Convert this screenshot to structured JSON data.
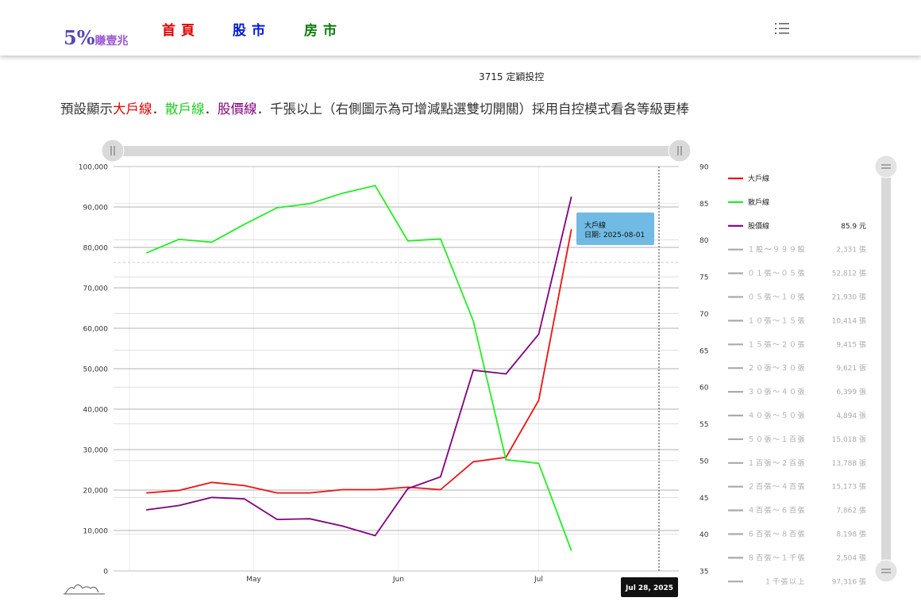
{
  "header": {
    "logo_main": "5%",
    "logo_sub": "賺壹兆",
    "nav": [
      {
        "label": "首頁",
        "color": "#e00000"
      },
      {
        "label": "股市",
        "color": "#0018d8"
      },
      {
        "label": "房市",
        "color": "#0a7a0a"
      }
    ],
    "menu_icon": "list-menu-icon"
  },
  "page_title": "3715 定穎投控",
  "intro": [
    {
      "text": "預設顯示",
      "color": "#333333"
    },
    {
      "text": "大戶線",
      "color": "#e00000"
    },
    {
      "text": "．",
      "color": "#333333"
    },
    {
      "text": "散戶線",
      "color": "#22cc22"
    },
    {
      "text": "．",
      "color": "#333333"
    },
    {
      "text": "股價線",
      "color": "#800080"
    },
    {
      "text": "．千張以上（右側圖示為可增減點選雙切開關）採用自控模式看各等級更棒",
      "color": "#333333"
    }
  ],
  "chart_data": {
    "type": "line",
    "x_ticks": [
      {
        "label": "May",
        "date": "2025-05-01"
      },
      {
        "label": "Jun",
        "date": "2025-06-01"
      },
      {
        "label": "Jul",
        "date": "2025-07-01"
      }
    ],
    "x": [
      "2025-04-08",
      "2025-04-15",
      "2025-04-22",
      "2025-04-29",
      "2025-05-06",
      "2025-05-13",
      "2025-05-20",
      "2025-05-27",
      "2025-06-03",
      "2025-06-10",
      "2025-06-17",
      "2025-06-24",
      "2025-07-01",
      "2025-07-08",
      "2025-07-15"
    ],
    "y_left": {
      "min": 0,
      "max": 100000,
      "step": 10000
    },
    "y_right": {
      "min": 35,
      "max": 90,
      "step": 5
    },
    "series": [
      {
        "name": "大戶線",
        "color": "#ee1111",
        "axis": "left",
        "values": [
          19300,
          19900,
          21900,
          21100,
          19300,
          19300,
          20100,
          20100,
          20700,
          20100,
          27000,
          28100,
          42200,
          84500,
          null
        ]
      },
      {
        "name": "散戶線",
        "color": "#22ee22",
        "axis": "left",
        "values": [
          78600,
          82000,
          81300,
          85700,
          89800,
          90800,
          93400,
          95300,
          81600,
          82100,
          61800,
          27500,
          26600,
          5000,
          null
        ]
      },
      {
        "name": "股價線",
        "color": "#800080",
        "axis": "right",
        "values": [
          43.3,
          43.9,
          45.0,
          44.8,
          42.0,
          42.1,
          41.1,
          39.8,
          46.2,
          47.8,
          62.3,
          61.8,
          67.2,
          85.9,
          null
        ]
      }
    ],
    "hover_date_label": "Jul 28, 2025",
    "tooltip": {
      "series": "大戶線",
      "date_label": "日期: 2025-08-01"
    },
    "grid": true,
    "legend_position": "right",
    "legend": [
      {
        "label": "大戶線",
        "value": "",
        "color": "#ee1111",
        "active": true
      },
      {
        "label": "散戶線",
        "value": "",
        "color": "#22ee22",
        "active": true
      },
      {
        "label": "股價線",
        "value": "85.9 元",
        "color": "#800080",
        "active": true
      },
      {
        "label": "１股～９９９股",
        "value": "2,331 張",
        "color": "#aaaaaa",
        "active": false
      },
      {
        "label": "０１張～０５張",
        "value": "52,812 張",
        "color": "#aaaaaa",
        "active": false
      },
      {
        "label": "０５張～１０張",
        "value": "21,930 張",
        "color": "#aaaaaa",
        "active": false
      },
      {
        "label": "１０張～１５張",
        "value": "10,414 張",
        "color": "#aaaaaa",
        "active": false
      },
      {
        "label": "１５張～２０張",
        "value": "9,415 張",
        "color": "#aaaaaa",
        "active": false
      },
      {
        "label": "２０張～３０張",
        "value": "9,621 張",
        "color": "#aaaaaa",
        "active": false
      },
      {
        "label": "３０張～４０張",
        "value": "6,399 張",
        "color": "#aaaaaa",
        "active": false
      },
      {
        "label": "４０張～５０張",
        "value": "4,894 張",
        "color": "#aaaaaa",
        "active": false
      },
      {
        "label": "５０張～１百張",
        "value": "15,018 張",
        "color": "#aaaaaa",
        "active": false
      },
      {
        "label": "１百張～２百張",
        "value": "13,788 張",
        "color": "#aaaaaa",
        "active": false
      },
      {
        "label": "２百張～４百張",
        "value": "15,173 張",
        "color": "#aaaaaa",
        "active": false
      },
      {
        "label": "４百張～６百張",
        "value": "7,862 張",
        "color": "#aaaaaa",
        "active": false
      },
      {
        "label": "６百張～８百張",
        "value": "8,198 張",
        "color": "#aaaaaa",
        "active": false
      },
      {
        "label": "８百張～１千張",
        "value": "2,504 張",
        "color": "#aaaaaa",
        "active": false
      },
      {
        "label": "１千張以上",
        "value": "97,316 張",
        "color": "#aaaaaa",
        "active": false
      }
    ]
  }
}
